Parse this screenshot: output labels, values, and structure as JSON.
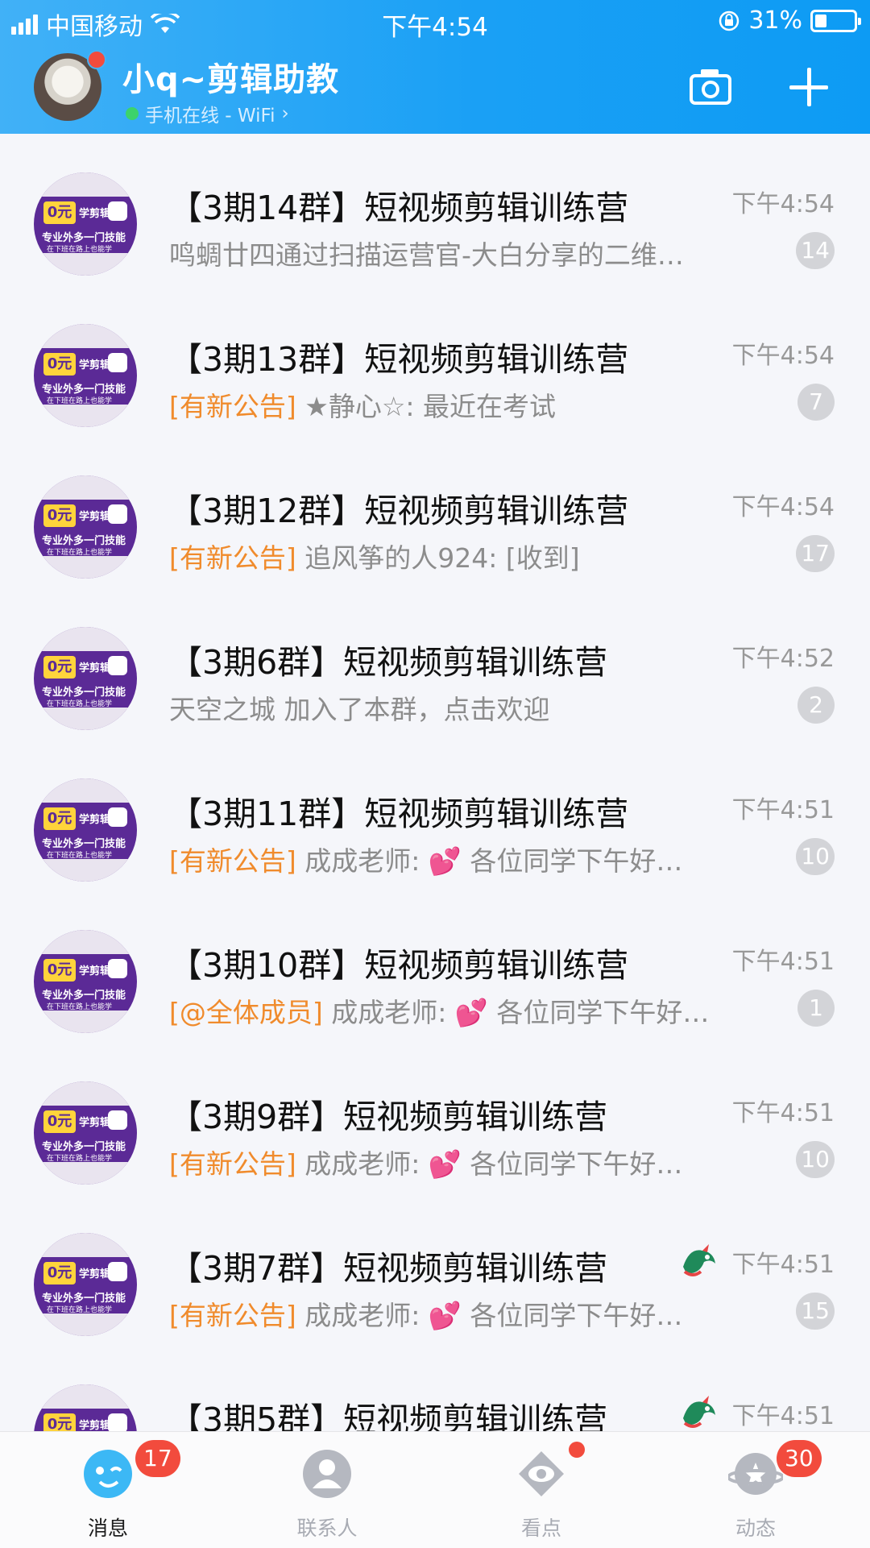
{
  "status_bar": {
    "carrier": "中国移动",
    "time": "下午4:54",
    "battery": "31%",
    "battery_level": 0.31
  },
  "header": {
    "name": "小q~剪辑助教",
    "status": "手机在线 - WiFi",
    "status_chevron": "›"
  },
  "colors": {
    "header": "#1aa0f5",
    "tag": "#f08b2c",
    "badge_red": "#f24b3d",
    "thumb_purple": "#5b2a96"
  },
  "thumb_text": {
    "zero": "0元",
    "l1": "学剪辑",
    "l2": "专业外多一门技能",
    "l3": "在下班在路上也能学"
  },
  "chats": [
    {
      "title": "【3期14群】短视频剪辑训练营",
      "time": "下午4:54",
      "tag": "",
      "preview": "鸣蜩廿四通过扫描运营官-大白分享的二维…",
      "count": "14",
      "dragon": false
    },
    {
      "title": "【3期13群】短视频剪辑训练营",
      "time": "下午4:54",
      "tag": "[有新公告]",
      "preview": " ★静心☆: 最近在考试",
      "count": "7",
      "dragon": false
    },
    {
      "title": "【3期12群】短视频剪辑训练营",
      "time": "下午4:54",
      "tag": "[有新公告]",
      "preview": " 追风筝的人924: [收到]",
      "count": "17",
      "dragon": false
    },
    {
      "title": "【3期6群】短视频剪辑训练营",
      "time": "下午4:52",
      "tag": "",
      "preview": "天空之城 加入了本群，点击欢迎",
      "count": "2",
      "dragon": false
    },
    {
      "title": "【3期11群】短视频剪辑训练营",
      "time": "下午4:51",
      "tag": "[有新公告]",
      "preview": " 成成老师: 💕 各位同学下午好…",
      "count": "10",
      "dragon": false
    },
    {
      "title": "【3期10群】短视频剪辑训练营",
      "time": "下午4:51",
      "tag": "[@全体成员]",
      "preview": " 成成老师: 💕 各位同学下午好…",
      "count": "1",
      "dragon": false
    },
    {
      "title": "【3期9群】短视频剪辑训练营",
      "time": "下午4:51",
      "tag": "[有新公告]",
      "preview": " 成成老师: 💕 各位同学下午好…",
      "count": "10",
      "dragon": false
    },
    {
      "title": "【3期7群】短视频剪辑训练营",
      "time": "下午4:51",
      "tag": "[有新公告]",
      "preview": " 成成老师: 💕 各位同学下午好…",
      "count": "15",
      "dragon": true
    },
    {
      "title": "【3期5群】短视频剪辑训练营",
      "time": "下午4:51",
      "tag": "",
      "preview": "",
      "count": "",
      "dragon": true
    }
  ],
  "tabs": [
    {
      "label": "消息",
      "badge": "17",
      "icon": "messages-icon",
      "active": true
    },
    {
      "label": "联系人",
      "badge": "",
      "icon": "contacts-icon",
      "active": false
    },
    {
      "label": "看点",
      "badge": "",
      "icon": "eye-icon",
      "active": false
    },
    {
      "label": "动态",
      "badge": "30",
      "icon": "star-planet-icon",
      "active": false
    }
  ]
}
